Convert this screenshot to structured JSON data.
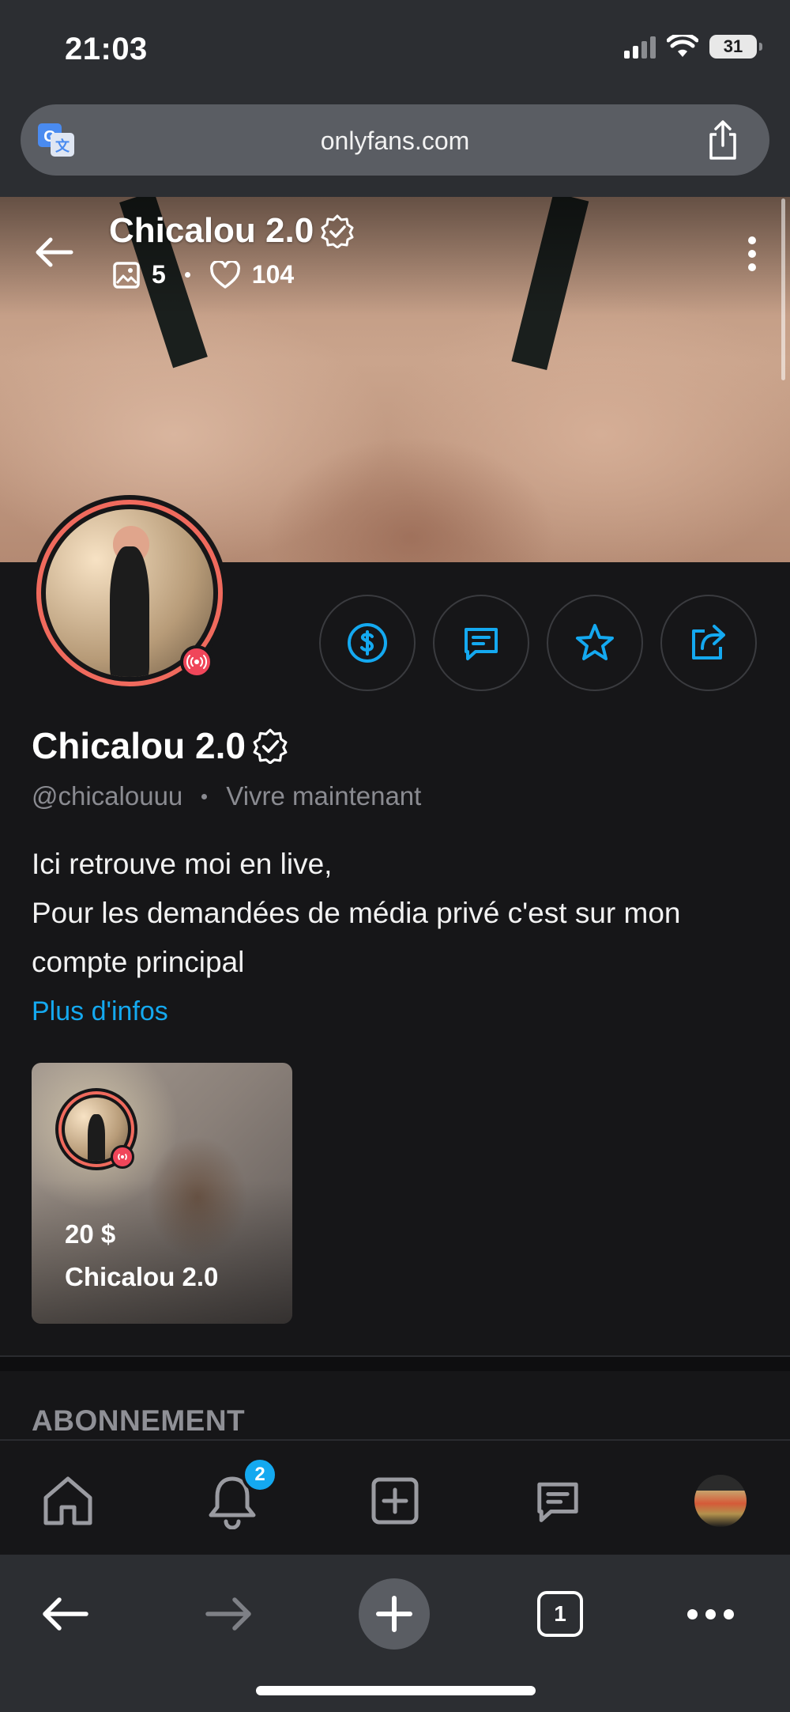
{
  "status_bar": {
    "time": "21:03",
    "battery": "31"
  },
  "browser": {
    "url": "onlyfans.com",
    "tab_count": "1"
  },
  "profile": {
    "name": "Chicalou 2.0",
    "media_count": "5",
    "likes_count": "104",
    "handle": "@chicalouuu",
    "status": "Vivre maintenant",
    "bio_lines": [
      "Ici retrouve moi en live,",
      "Pour les demandées de média privé c'est sur mon compte principal"
    ],
    "more_info_label": "Plus d'infos"
  },
  "stream_card": {
    "price": "20 $",
    "title": "Chicalou 2.0"
  },
  "section": {
    "title": "ABONNEMENT"
  },
  "tab_bar": {
    "notifications_badge": "2"
  },
  "colors": {
    "accent": "#14a9f0",
    "live": "#f0465a",
    "avatar_ring": "#f06a5d",
    "background": "#161618"
  },
  "icons": {
    "cover": [
      "back-arrow-icon",
      "image-icon",
      "heart-icon",
      "more-vertical-icon"
    ],
    "actions": [
      "dollar-icon",
      "message-icon",
      "star-icon",
      "share-icon"
    ],
    "tabs": [
      "home-icon",
      "bell-icon",
      "add-post-icon",
      "messages-icon",
      "profile-avatar"
    ],
    "browser": [
      "translate-icon",
      "share-icon",
      "back-icon",
      "forward-icon",
      "new-tab-icon",
      "tabs-icon",
      "more-icon"
    ]
  }
}
